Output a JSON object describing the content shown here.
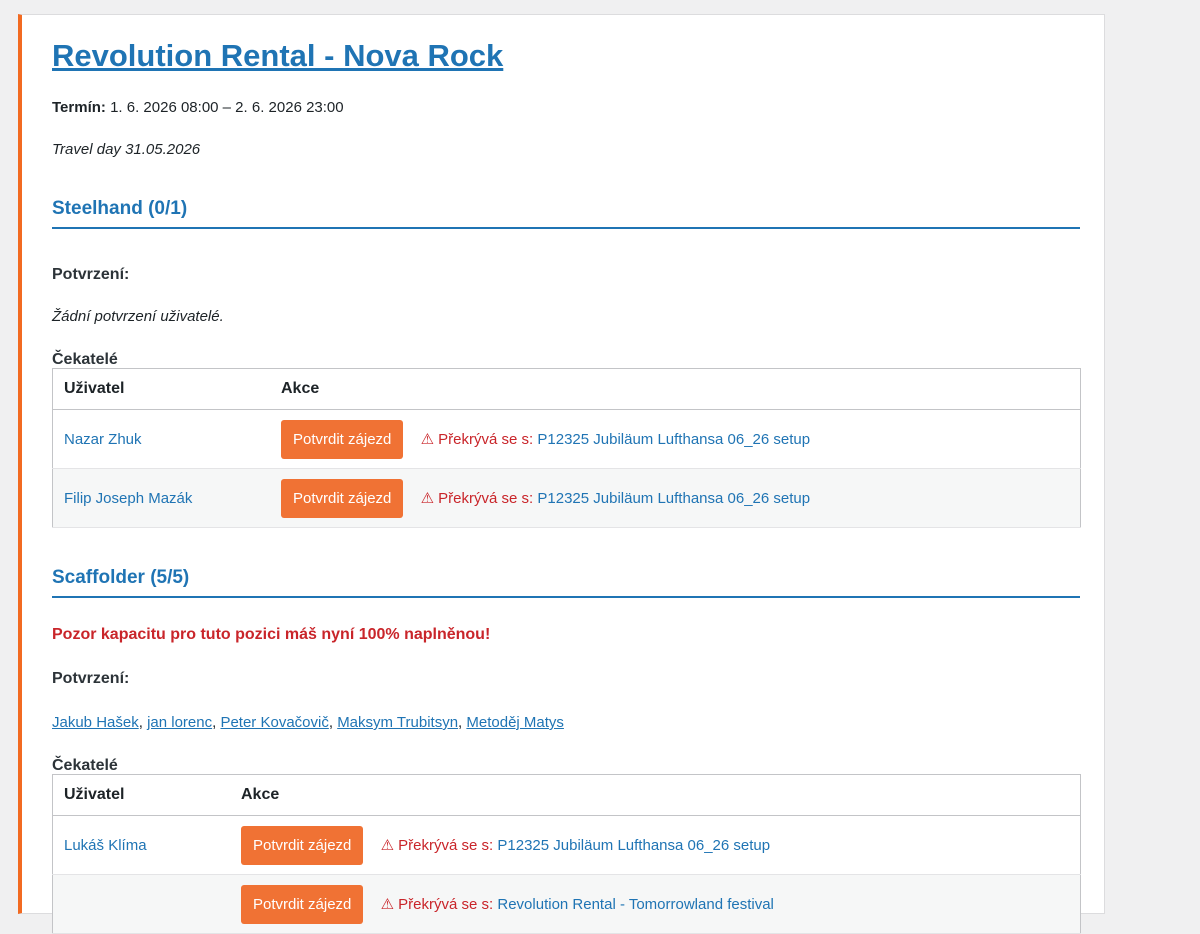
{
  "event": {
    "title": "Revolution Rental - Nova Rock",
    "term_label": "Termín:",
    "term_value": "1. 6. 2026 08:00 – 2. 6. 2026 23:00",
    "travel_note": "Travel day 31.05.2026"
  },
  "sections": [
    {
      "heading": "Steelhand (0/1)",
      "confirmed_label": "Potvrzení:",
      "no_confirmed_text": "Žádní potvrzení uživatelé.",
      "waiters_label": "Čekatelé",
      "table_headers": [
        "Uživatel",
        "Akce"
      ],
      "rows": [
        {
          "user": "Nazar Zhuk",
          "button": "Potvrdit zájezd",
          "overlap_prefix": "⚠ Překrývá se s:",
          "overlap_link": "P12325 Jubiläum Lufthansa 06_26 setup"
        },
        {
          "user": "Filip Joseph Mazák",
          "button": "Potvrdit zájezd",
          "overlap_prefix": "⚠ Překrývá se s:",
          "overlap_link": "P12325 Jubiläum Lufthansa 06_26 setup"
        }
      ]
    },
    {
      "heading": "Scaffolder (5/5)",
      "capacity_warning": "Pozor kapacitu pro tuto pozici máš nyní 100% naplněnou!",
      "confirmed_label": "Potvrzení:",
      "confirmed_users": [
        "Jakub Hašek",
        "jan lorenc",
        "Peter Kovačovič",
        "Maksym Trubitsyn",
        "Metoděj Matys"
      ],
      "separator": ", ",
      "waiters_label": "Čekatelé",
      "table_headers": [
        "Uživatel",
        "Akce"
      ],
      "rows": [
        {
          "user": "Lukáš Klíma",
          "button": "Potvrdit zájezd",
          "overlap_prefix": "⚠ Překrývá se s:",
          "overlap_link": "P12325 Jubiläum Lufthansa 06_26 setup"
        },
        {
          "user": "",
          "button": "Potvrdit zájezd",
          "overlap_prefix": "⚠ Překrývá se s:",
          "overlap_link": "Revolution Rental - Tomorrowland festival"
        }
      ]
    }
  ],
  "colors": {
    "accent_bar": "#f26a21",
    "link": "#1f74b4",
    "button": "#f07234",
    "warning": "#c9252a"
  }
}
